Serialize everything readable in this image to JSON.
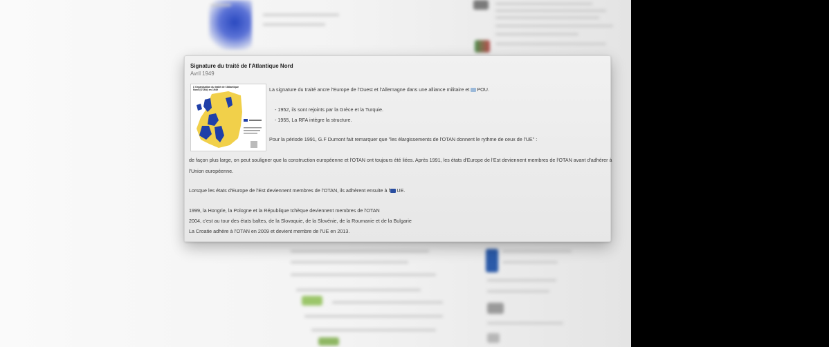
{
  "card": {
    "title": "Signature du traité de l'Atlantique Nord",
    "date": "Avril 1949",
    "thumbnail": {
      "title": "L'Organisation du traité de l'Atlantique Nord (OTAN) en 1949"
    },
    "paragraph1": "La signature du traité ancre l'Europe de l'Ouest et l'Allemagne dans une alliance militaire et",
    "paragraph1_link": "POU.",
    "bullet1": "- 1952, ils sont rejoints par la Grèce et la Turquie.",
    "bullet2": "- 1955, La RFA intègre la structure.",
    "paragraph2": "Pour la période 1991, G.F Dumont fait remarquer que \"les élargissements de l'OTAN donnent le rythme de ceux de l'UE\" :",
    "paragraph3_line1": "de façon plus large, on peut souligner que la construction européenne et l'OTAN ont toujours été liées. Après 1991, les états d'Europe de l'Est deviennent membres de l'OTAN avant d'adhérer à",
    "paragraph3_line2": "l'Union européenne.",
    "paragraph4": "Lorsque les états d'Europe de l'Est deviennent membres de l'OTAN, ils adhèrent ensuite à l'",
    "paragraph4_link": "UE.",
    "line_1999": "1999, la Hongrie, la Pologne et la République tchèque deviennent membres de l'OTAN",
    "line_2004": "2004, c'est au tour des états baltes, de la Slovaquie, de la Slovénie, de la Roumanie et de la Bulgarie",
    "line_croatia": "La Croatie adhère à l'OTAN en 2009 et devient membre de l'UE en 2013."
  },
  "colors": {
    "nato_blue": "#1f3fa8",
    "land_yellow": "#f1d04a",
    "sea": "#ffffff",
    "card_bg": "#eeeeee",
    "screen_black": "#000000"
  },
  "icons": {
    "nato_flag": "nato-flag-icon",
    "eu_flag": "eu-flag-icon"
  }
}
